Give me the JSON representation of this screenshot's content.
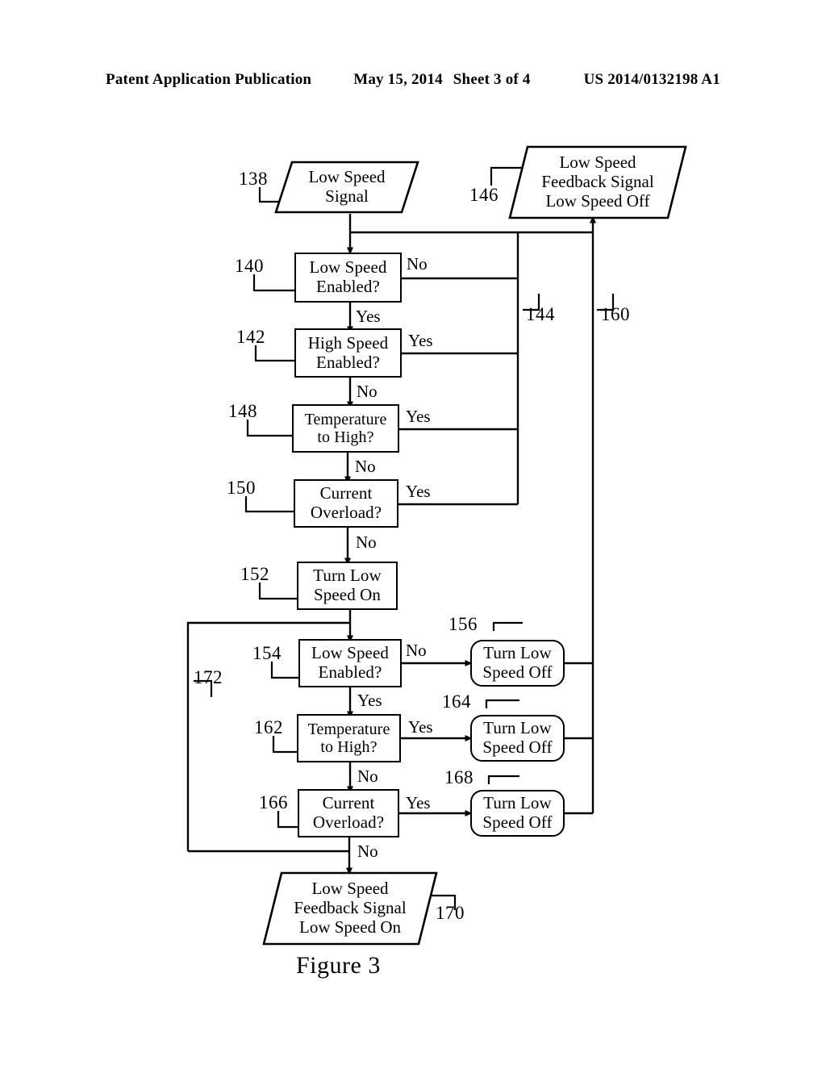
{
  "header": {
    "publication": "Patent Application Publication",
    "date": "May 15, 2014",
    "sheet": "Sheet 3 of 4",
    "number": "US 2014/0132198 A1"
  },
  "figure": {
    "caption": "Figure 3",
    "ink_color": "#000000",
    "background": "#ffffff"
  },
  "nodes": {
    "n138": {
      "ref": "138",
      "shape": "parallelogram",
      "lines": [
        "Low Speed",
        "Signal"
      ]
    },
    "n146": {
      "ref": "146",
      "shape": "parallelogram",
      "lines": [
        "Low Speed",
        "Feedback Signal",
        "Low Speed Off"
      ]
    },
    "n140": {
      "ref": "140",
      "shape": "rectangle",
      "lines": [
        "Low Speed",
        "Enabled?"
      ]
    },
    "n142": {
      "ref": "142",
      "shape": "rectangle",
      "lines": [
        "High Speed",
        "Enabled?"
      ]
    },
    "n148": {
      "ref": "148",
      "shape": "rectangle",
      "lines": [
        "Temperature",
        "to High?"
      ]
    },
    "n150": {
      "ref": "150",
      "shape": "rectangle",
      "lines": [
        "Current",
        "Overload?"
      ]
    },
    "n152": {
      "ref": "152",
      "shape": "rectangle",
      "lines": [
        "Turn Low",
        "Speed On"
      ]
    },
    "n154": {
      "ref": "154",
      "shape": "rectangle",
      "lines": [
        "Low Speed",
        "Enabled?"
      ]
    },
    "n162": {
      "ref": "162",
      "shape": "rectangle",
      "lines": [
        "Temperature",
        "to High?"
      ]
    },
    "n166": {
      "ref": "166",
      "shape": "rectangle",
      "lines": [
        "Current",
        "Overload?"
      ]
    },
    "n156": {
      "ref": "156",
      "shape": "rounded-rectangle",
      "lines": [
        "Turn Low",
        "Speed Off"
      ]
    },
    "n164": {
      "ref": "164",
      "shape": "rounded-rectangle",
      "lines": [
        "Turn Low",
        "Speed Off"
      ]
    },
    "n168": {
      "ref": "168",
      "shape": "rounded-rectangle",
      "lines": [
        "Turn Low",
        "Speed Off"
      ]
    },
    "n170": {
      "ref": "170",
      "shape": "parallelogram",
      "lines": [
        "Low Speed",
        "Feedback Signal",
        "Low Speed On"
      ]
    }
  },
  "bus_refs": {
    "b144": "144",
    "b160": "160",
    "b172": "172"
  },
  "edge_labels": {
    "e140_no": "No",
    "e140_yes": "Yes",
    "e142_yes": "Yes",
    "e142_no": "No",
    "e148_yes": "Yes",
    "e148_no": "No",
    "e150_yes": "Yes",
    "e150_no": "No",
    "e154_no": "No",
    "e154_yes": "Yes",
    "e162_yes": "Yes",
    "e162_no": "No",
    "e166_yes": "Yes",
    "e166_no": "No"
  }
}
